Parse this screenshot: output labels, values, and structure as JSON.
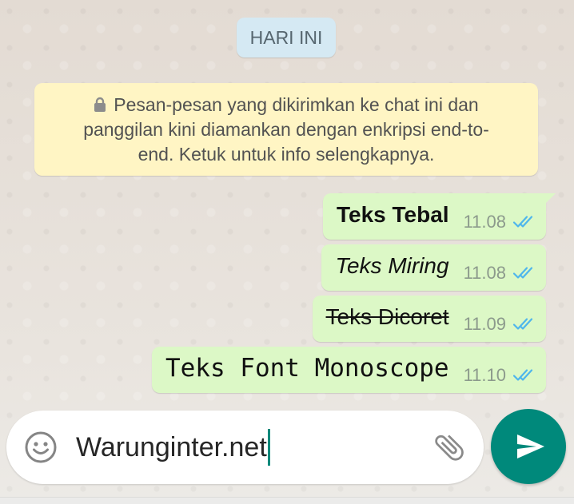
{
  "chat": {
    "date_chip": "HARI INI",
    "encryption_notice": {
      "icon": "lock-icon",
      "lines": [
        "Pesan-pesan yang dikirimkan ke chat ini dan",
        "panggilan kini diamankan dengan enkripsi end-to-",
        "end. Ketuk untuk info selengkapnya."
      ]
    },
    "messages": [
      {
        "text": "Teks Tebal",
        "time": "11.08",
        "status_icon": "double-check-icon"
      },
      {
        "text": "Teks Miring",
        "time": "11.08",
        "status_icon": "double-check-icon"
      },
      {
        "text": "Teks Dicoret",
        "time": "11.09",
        "status_icon": "double-check-icon"
      },
      {
        "text": "Teks Font Monoscope",
        "time": "11.10",
        "status_icon": "double-check-icon"
      }
    ]
  },
  "composer": {
    "emoji_icon": "smiley-icon",
    "input_value": "Warunginter.net",
    "attach_icon": "paperclip-icon",
    "send_icon": "send-icon"
  },
  "colors": {
    "accent": "#00897B",
    "bubble": "#DCF8C6",
    "read_check": "#4FB6EC",
    "chip_bg": "#D5E9F3",
    "notice_bg": "#FFF5C4",
    "chat_bg": "#E6DED6"
  }
}
